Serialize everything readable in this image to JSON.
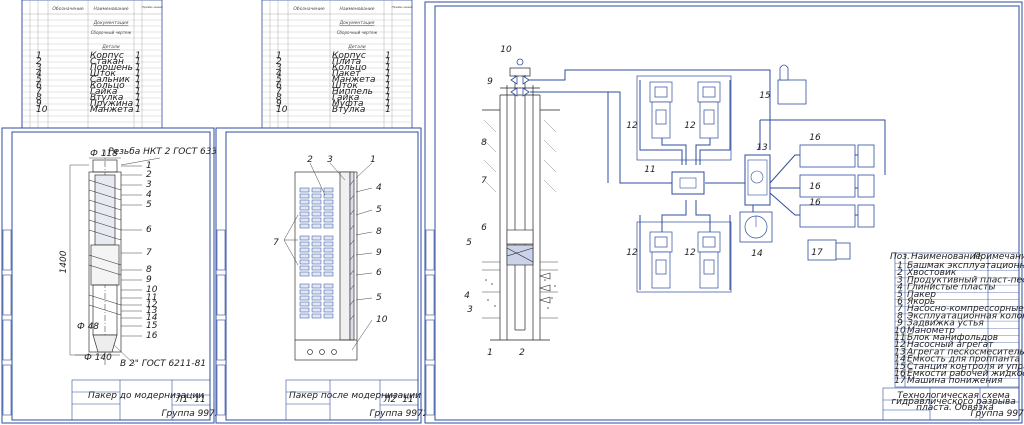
{
  "sheet1": {
    "headers": {
      "designation": "Обозначение",
      "name": "Наименование",
      "note": "Приме-чание"
    },
    "sections": {
      "documentation": "Документация",
      "assembly_drawing": "Сборочный чертеж",
      "parts": "Детали"
    },
    "rows": [
      "Корпус",
      "Стакан",
      "Поршень",
      "Шток",
      "Сальник",
      "Кольцо",
      "Гайка",
      "Втулка",
      "Пружина",
      "Манжета"
    ]
  },
  "sheet2": {
    "headers": {
      "designation": "Обозначение",
      "name": "Наименование",
      "note": "Приме-чание"
    },
    "sections": {
      "documentation": "Документация",
      "assembly_drawing": "Сборочный чертеж",
      "parts": "Детали"
    },
    "rows": [
      "Корпус",
      "Плита",
      "Кольцо",
      "Пакет",
      "Манжета",
      "Шток",
      "Ниппель",
      "Гайка",
      "Муфта",
      "Втулка"
    ]
  },
  "sheet3": {
    "thread_label": "Резьба НКТ 2 ГОСТ 633-80",
    "dim_top": "Ф 118",
    "dim_length": "1400",
    "dim_bottom": "Ф 140",
    "dim_inner": "Ф 48",
    "thread_bottom": "В 2\" ГОСТ 6211-81",
    "callouts": [
      "1",
      "2",
      "3",
      "4",
      "5",
      "6",
      "7",
      "8",
      "9",
      "10",
      "11",
      "12",
      "13",
      "14",
      "15",
      "16"
    ],
    "title": "Пакер до модернизации",
    "group": "Группа 9972",
    "sheet_no": "Л1",
    "sheets": "11"
  },
  "sheet4": {
    "callouts_top": [
      "2",
      "3",
      "1"
    ],
    "callouts_right": [
      "4",
      "5",
      "8",
      "9",
      "6",
      "5",
      "10"
    ],
    "callout_left": "7",
    "title": "Пакер после модернизации",
    "group": "Группа 9972",
    "sheet_no": "Л2",
    "sheets": "11"
  },
  "sheet5": {
    "labels": [
      "1",
      "2",
      "3",
      "4",
      "5",
      "6",
      "7",
      "8",
      "9",
      "10",
      "11",
      "12",
      "12",
      "12",
      "12",
      "13",
      "14",
      "15",
      "16",
      "16",
      "16",
      "17"
    ],
    "title": "Технологическая схема гидравлического разрыва пласта. Обвязка",
    "group": "Группа 9972",
    "legend_headers": {
      "pos": "Поз.",
      "name": "Наименование",
      "note": "Примечание"
    },
    "legend": [
      {
        "pos": "1",
        "name": "Башмак эксплуатационной колонны"
      },
      {
        "pos": "2",
        "name": "Хвостовик"
      },
      {
        "pos": "3",
        "name": "Продуктивный пласт-песчаник"
      },
      {
        "pos": "4",
        "name": "Глинистые пласты"
      },
      {
        "pos": "5",
        "name": "Пакер"
      },
      {
        "pos": "6",
        "name": "Якорь"
      },
      {
        "pos": "7",
        "name": "Насосно-компрессорные трубы"
      },
      {
        "pos": "8",
        "name": "Эксплуатационная колонна"
      },
      {
        "pos": "9",
        "name": "Задвижка устья"
      },
      {
        "pos": "10",
        "name": "Манометр"
      },
      {
        "pos": "11",
        "name": "Блок манифольдов"
      },
      {
        "pos": "12",
        "name": "Насосный агрегат"
      },
      {
        "pos": "13",
        "name": "Агрегат пескосмесительный"
      },
      {
        "pos": "14",
        "name": "Ёмкость для проппанта"
      },
      {
        "pos": "15",
        "name": "Станция контроля и управления процессом"
      },
      {
        "pos": "16",
        "name": "Ёмкости рабочей жидкости"
      },
      {
        "pos": "17",
        "name": "Машина понижения"
      }
    ]
  }
}
